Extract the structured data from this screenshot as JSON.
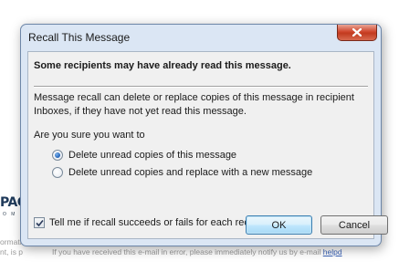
{
  "background": {
    "logo_text": "PACI",
    "logo_sub": "O M",
    "line1": "ormati",
    "line2_prefix": "nt, is p",
    "line2_tail": "If you have received this e-mail in error, please immediately notify us by e-mail",
    "line2_link": "helpd"
  },
  "dialog": {
    "title": "Recall This Message",
    "heading": "Some recipients may have already read this message.",
    "description": "Message recall can delete or replace copies of this message in recipient Inboxes, if they have not yet read this message.",
    "question": "Are you sure you want to",
    "options": [
      {
        "label": "Delete unread copies of this message",
        "selected": true
      },
      {
        "label": "Delete unread copies and replace with a new message",
        "selected": false
      }
    ],
    "notify_checkbox": {
      "label": "Tell me if recall succeeds or fails for each recipient",
      "checked": true
    },
    "ok_label": "OK",
    "cancel_label": "Cancel",
    "close_icon": "close-icon"
  },
  "colors": {
    "frame": "#dbe6f4",
    "close_button": "#c94a30",
    "default_button_border": "#3c7fb1"
  }
}
